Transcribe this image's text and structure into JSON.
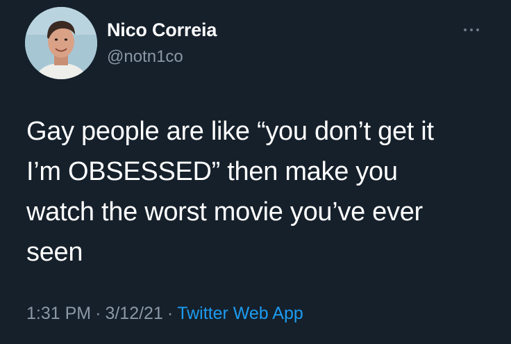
{
  "author": {
    "display_name": "Nico Correia",
    "handle": "@notn1co"
  },
  "tweet": {
    "lines": [
      "Gay people are like “you don’t get it",
      "I’m OBSESSED” then make you",
      "watch the worst movie you’ve ever",
      "seen"
    ]
  },
  "meta": {
    "time": "1:31 PM",
    "separator": "·",
    "date": "3/12/21",
    "source": "Twitter Web App"
  },
  "icons": {
    "avatar": "profile-photo",
    "more": "more-horizontal-icon"
  },
  "colors": {
    "background": "#15202b",
    "primary_text": "#ffffff",
    "secondary_text": "#8b98a5",
    "link": "#1d9bf0"
  }
}
